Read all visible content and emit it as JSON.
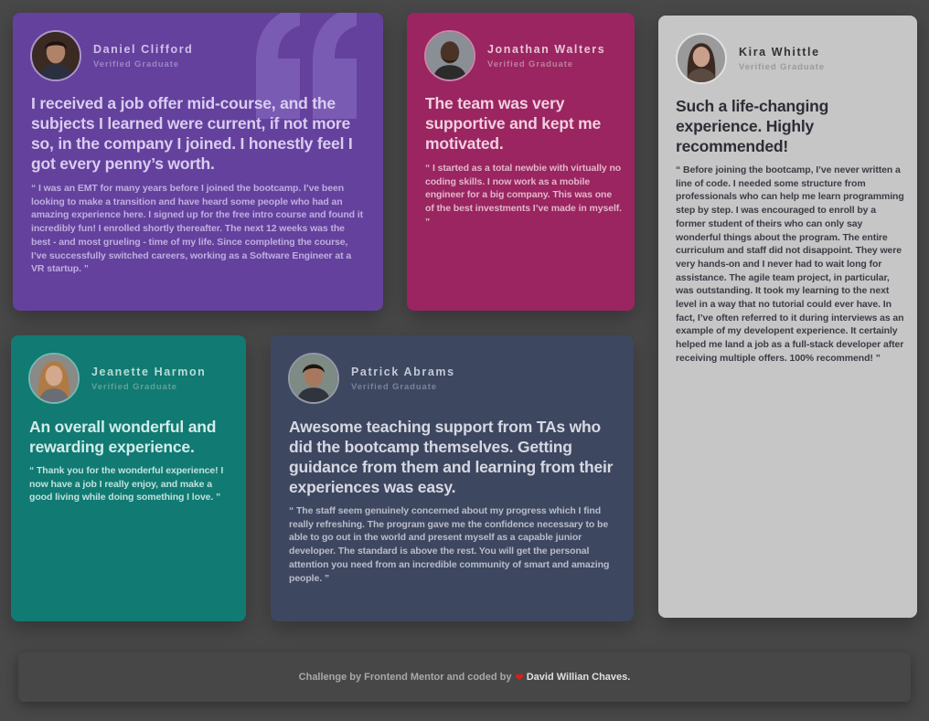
{
  "testimonials": [
    {
      "name": "Daniel Clifford",
      "role": "Verified Graduate",
      "avatar_icon": "person-avatar-icon",
      "headline": "I received a job offer mid-course, and the subjects I learned were current, if not more so, in the company I joined. I honestly feel I got every penny’s worth.",
      "quote": "“ I was an EMT for many years before I joined the bootcamp. I’ve been looking to make a transition and have heard some people who had an amazing experience here. I signed up for the free intro course and found it incredibly fun! I enrolled shortly thereafter. The next 12 weeks was the best - and most grueling - time of my life. Since completing the course, I’ve successfully switched careers, working as a Software Engineer at a VR startup. ”",
      "background": "#64419d"
    },
    {
      "name": "Jonathan Walters",
      "role": "Verified Graduate",
      "avatar_icon": "person-avatar-icon",
      "headline": "The team was very supportive and kept me motivated.",
      "quote": "“ I started as a total newbie with virtually no coding skills. I now work as a mobile engineer for a big company. This was one of the best investments I’ve made in myself. ”",
      "background": "#9a2560"
    },
    {
      "name": "Kira Whittle",
      "role": "Verified Graduate",
      "avatar_icon": "person-avatar-icon",
      "headline": "Such a life-changing experience. Highly recommended!",
      "quote": "“ Before joining the bootcamp, I’ve never written a line of code. I needed some structure from professionals who can help me learn programming step by step. I was encouraged to enroll by a former student of theirs who can only say wonderful things about the program. The entire curriculum and staff did not disappoint. They were very hands-on and I never had to wait long for assistance. The agile team project, in particular, was outstanding. It took my learning to the next level in a way that no tutorial could ever have. In fact, I’ve often referred to it during interviews as an example of my developent experience. It certainly helped me land a job as a full-stack developer after receiving multiple offers. 100% recommend! ”",
      "background": "#c6c6c6"
    },
    {
      "name": "Jeanette Harmon",
      "role": "Verified Graduate",
      "avatar_icon": "person-avatar-icon",
      "headline": "An overall wonderful and rewarding experience.",
      "quote": "“ Thank you for the wonderful experience! I now have a job I really enjoy, and make a good living while doing something I love. ”",
      "background": "#117a72"
    },
    {
      "name": "Patrick Abrams",
      "role": "Verified Graduate",
      "avatar_icon": "person-avatar-icon",
      "headline": "Awesome teaching support from TAs who did the bootcamp themselves. Getting guidance from them and learning from their experiences was easy.",
      "quote": "“ The staff seem genuinely concerned about my progress which I find really refreshing. The program gave me the confidence necessary to be able to go out in the world and present myself as a capable junior developer. The standard is above the rest. You will get the personal attention you need from an incredible community of smart and amazing people. ”",
      "background": "#3e4760"
    }
  ],
  "footer": {
    "prefix": "Challenge by Frontend Mentor and coded by",
    "heart_icon": "heart-icon",
    "author": "David Willian Chaves."
  },
  "colors": {
    "page_background": "#484848",
    "heart": "#d42020"
  }
}
